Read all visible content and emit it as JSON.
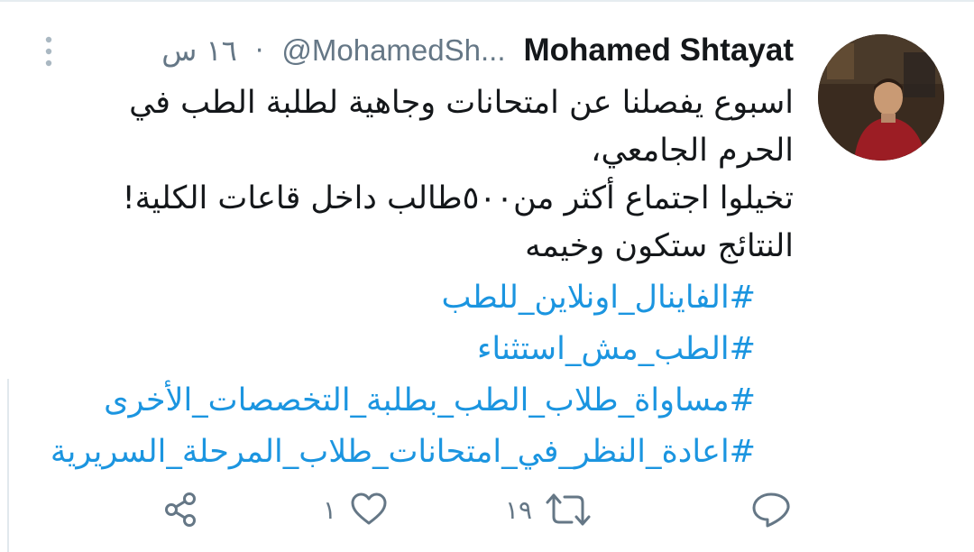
{
  "tweet": {
    "display_name": "Mohamed Shtayat",
    "handle": "@MohamedSh...",
    "time": "١٦ س",
    "separator": "·",
    "body_lines": [
      "اسبوع يفصلنا عن امتحانات وجاهية لطلبة الطب في",
      "الحرم الجامعي،",
      "تخيلوا اجتماع أكثر من٥٠٠طالب داخل قاعات الكلية!",
      "النتائج ستكون وخيمه"
    ],
    "hashtags": [
      "#الفاينال_اونلاين_للطب",
      "#الطب_مش_استثناء",
      "#مساواة_طلاب_الطب_بطلبة_التخصصات_الأخرى",
      "#اعادة_النظر_في_امتحانات_طلاب_المرحلة_السريرية"
    ]
  },
  "actions": {
    "reply_icon": "reply-icon",
    "retweet_icon": "retweet-icon",
    "retweet_count": "١٩",
    "like_icon": "heart-icon",
    "like_count": "١",
    "share_icon": "share-icon"
  },
  "colors": {
    "hashtag": "#1b95e0",
    "text": "#14171a",
    "muted": "#657786"
  }
}
